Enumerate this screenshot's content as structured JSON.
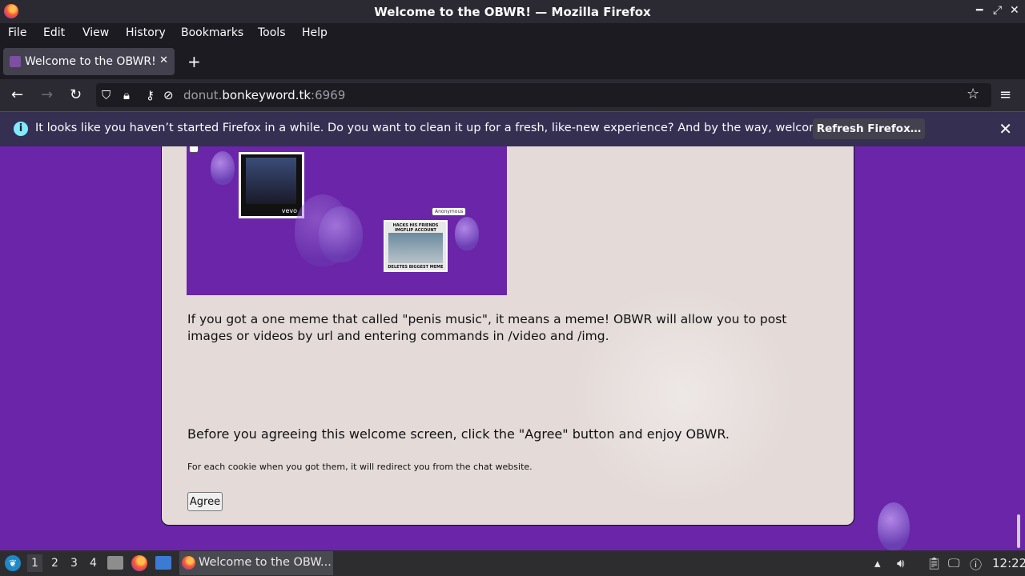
{
  "window": {
    "title": "Welcome to the OBWR! — Mozilla Firefox"
  },
  "menu": [
    "File",
    "Edit",
    "View",
    "History",
    "Bookmarks",
    "Tools",
    "Help"
  ],
  "tab": {
    "title": "Welcome to the OBWR!"
  },
  "url": {
    "prefix": "donut.",
    "host": "bonkeyword.tk",
    "port": ":6969"
  },
  "notification": {
    "message": "It looks like you haven’t started Firefox in a while. Do you want to clean it up for a fresh, like-new experience? And by the way, welcome back!",
    "button": "Refresh Firefox…"
  },
  "page": {
    "paragraph1": "If you got a one meme that called \"penis music\", it means a meme! OBWR will allow you to post images or videos by url and entering commands in /video and /img.",
    "paragraph2": "Before you agreeing this welcome screen, click the \"Agree\" button and enjoy OBWR.",
    "paragraph3": "For each cookie when you got them, it will redirect you from the chat website.",
    "agree_button": "Agree",
    "image": {
      "thumb1_caption": "vevo",
      "thumb2_top": "HACKS HIS FRIENDS IMGFLIP ACCOUNT",
      "thumb2_bottom": "DELETES BIGGEST MEME",
      "bubble": "Anonymous"
    }
  },
  "taskbar": {
    "workspaces": [
      "1",
      "2",
      "3",
      "4"
    ],
    "task": "Welcome to the OBW...",
    "clock": "12:22"
  },
  "colors": {
    "page_bg": "#6a25a8",
    "card_bg": "#e4dbd8",
    "chrome_dark": "#1c1b22"
  }
}
